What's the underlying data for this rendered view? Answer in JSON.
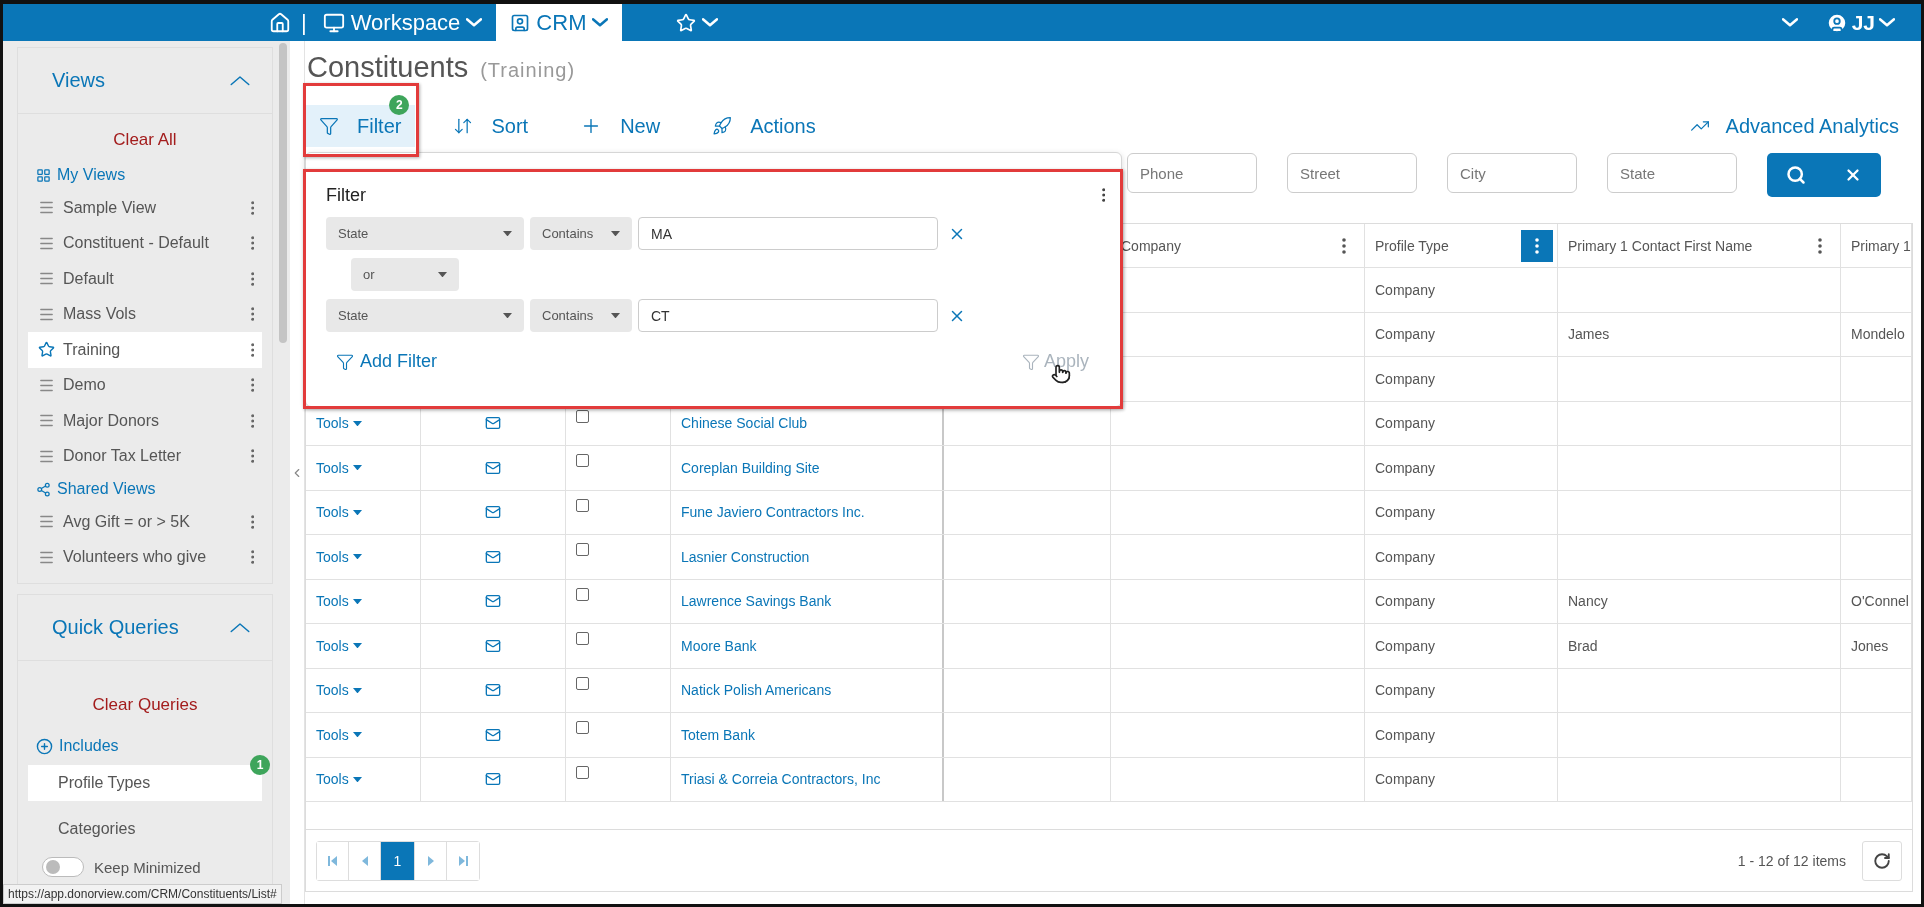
{
  "top_bar": {
    "separator": "|",
    "menus": [
      {
        "kind": "workspace",
        "label": "Workspace",
        "selected": false
      },
      {
        "kind": "crm",
        "label": "CRM",
        "selected": true
      },
      {
        "kind": "favorites",
        "selected": false
      }
    ],
    "user": {
      "initials": "JJ"
    }
  },
  "sidebar": {
    "views": {
      "title": "Views",
      "expanded": true,
      "clear_label": "Clear All",
      "my_views_label": "My Views",
      "my_views": [
        {
          "label": "Sample View",
          "selected": false,
          "starred": false
        },
        {
          "label": "Constituent - Default",
          "selected": false,
          "starred": false
        },
        {
          "label": "Default",
          "selected": false,
          "starred": false
        },
        {
          "label": "Mass Vols",
          "selected": false,
          "starred": false
        },
        {
          "label": "Training",
          "selected": true,
          "starred": true
        },
        {
          "label": "Demo",
          "selected": false,
          "starred": false
        },
        {
          "label": "Major Donors",
          "selected": false,
          "starred": false
        },
        {
          "label": "Donor Tax Letter",
          "selected": false,
          "starred": false
        }
      ],
      "shared_views_label": "Shared Views",
      "shared_views": [
        {
          "label": "Avg Gift = or > 5K",
          "selected": false,
          "starred": false
        },
        {
          "label": "Volunteers who give",
          "selected": false,
          "starred": false
        }
      ]
    },
    "quick_queries": {
      "title": "Quick Queries",
      "expanded": true,
      "clear_label": "Clear Queries",
      "includes_label": "Includes",
      "items": [
        {
          "label": "Profile Types",
          "selected": true,
          "badge": "1"
        },
        {
          "label": "Categories",
          "selected": false
        }
      ],
      "keep_minimized": {
        "label": "Keep Minimized",
        "on": false
      }
    },
    "status_url": "https://app.donorview.com/CRM/Constituents/List#"
  },
  "main": {
    "title": "Constituents",
    "subtitle": "(Training)",
    "toolbar": [
      {
        "kind": "filter",
        "label": "Filter",
        "selected": true,
        "badge": "2"
      },
      {
        "kind": "sort",
        "label": "Sort",
        "selected": false
      },
      {
        "kind": "new",
        "label": "New",
        "selected": false
      },
      {
        "kind": "actions",
        "label": "Actions",
        "selected": false
      }
    ],
    "analytics_link": "Advanced Analytics",
    "search_fields": [
      {
        "placeholder": "Phone"
      },
      {
        "placeholder": "Street"
      },
      {
        "placeholder": "City"
      },
      {
        "placeholder": "State"
      }
    ],
    "filter_panel": {
      "title": "Filter",
      "rows": [
        {
          "field": "State",
          "operator": "Contains",
          "value": "MA"
        },
        {
          "field": "State",
          "operator": "Contains",
          "value": "CT"
        }
      ],
      "joiner": "or",
      "add_label": "Add Filter",
      "apply_label": "Apply",
      "apply_disabled": true
    },
    "grid": {
      "columns": [
        {
          "label": "Company",
          "menu_selected": false
        },
        {
          "label": "Profile Type",
          "menu_selected": true
        },
        {
          "label": "Primary 1 Contact First Name",
          "menu_selected": false
        },
        {
          "label": "Primary 1"
        }
      ],
      "rows": [
        {
          "profile_type": "Company"
        },
        {
          "profile_type": "Company",
          "first_name": "James",
          "column_last": "Mondelo"
        },
        {
          "profile_type": "Company"
        },
        {
          "tools": "Tools",
          "checked": false,
          "name": "Chinese Social Club",
          "profile_type": "Company"
        },
        {
          "tools": "Tools",
          "checked": false,
          "name": "Coreplan Building Site",
          "profile_type": "Company"
        },
        {
          "tools": "Tools",
          "checked": false,
          "name": "Fune Javiero Contractors Inc.",
          "profile_type": "Company"
        },
        {
          "tools": "Tools",
          "checked": false,
          "name": "Lasnier Construction",
          "profile_type": "Company"
        },
        {
          "tools": "Tools",
          "checked": false,
          "name": "Lawrence Savings Bank",
          "profile_type": "Company",
          "first_name": "Nancy",
          "column_last": "O'Connel"
        },
        {
          "tools": "Tools",
          "checked": false,
          "name": "Moore Bank",
          "profile_type": "Company",
          "first_name": "Brad",
          "column_last": "Jones"
        },
        {
          "tools": "Tools",
          "checked": false,
          "name": "Natick Polish Americans",
          "profile_type": "Company"
        },
        {
          "tools": "Tools",
          "checked": false,
          "name": "Totem Bank",
          "profile_type": "Company"
        },
        {
          "tools": "Tools",
          "checked": false,
          "name": "Triasi & Correia Contractors, Inc",
          "profile_type": "Company"
        }
      ],
      "pages": [
        {
          "label": "1",
          "selected": true
        }
      ],
      "summary": "1 - 12 of 12 items"
    }
  }
}
